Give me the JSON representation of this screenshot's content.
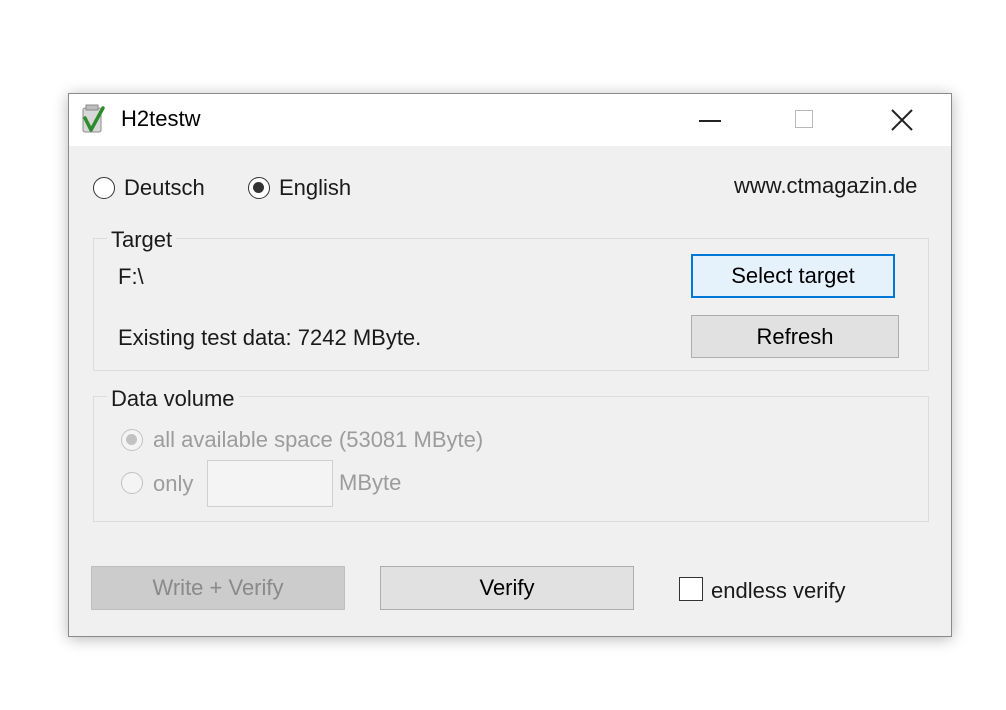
{
  "window": {
    "title": "H2testw",
    "icon": "h2testw-app-icon",
    "controls": [
      "minimize-icon",
      "maximize-icon",
      "close-icon"
    ]
  },
  "language": {
    "options": [
      {
        "label": "Deutsch",
        "checked": false
      },
      {
        "label": "English",
        "checked": true
      }
    ],
    "website": "www.ctmagazin.de"
  },
  "target": {
    "group_title": "Target",
    "path": "F:\\",
    "existing": "Existing test data: 7242 MByte.",
    "select_button": "Select target",
    "refresh_button": "Refresh"
  },
  "data_volume": {
    "group_title": "Data volume",
    "all_label": "all available space (53081 MByte)",
    "only_label": "only",
    "only_value": "",
    "unit": "MByte",
    "selected": "all",
    "disabled": true
  },
  "actions": {
    "write_verify": "Write + Verify",
    "verify": "Verify",
    "endless_label": "endless verify",
    "endless_checked": false
  },
  "colors": {
    "accent": "#0078d7",
    "window_bg": "#f0f0f0",
    "disabled_text": "#9c9c9c"
  }
}
